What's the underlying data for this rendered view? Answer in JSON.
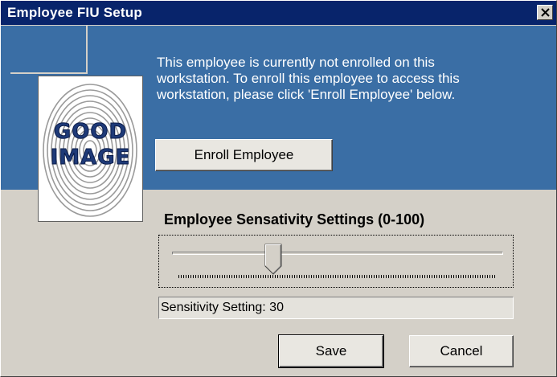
{
  "window": {
    "title": "Employee FIU Setup",
    "titlebar_color": "#08246b",
    "panel_color": "#3a6ea5"
  },
  "message": {
    "lines": [
      "This employee is currently not enrolled on this",
      "workstation.  To enroll this employee to access this",
      "workstation, please click 'Enroll Employee' below."
    ]
  },
  "fingerprint_card": {
    "icon": "fingerprint-icon",
    "line1": "GOOD",
    "line2": "IMAGE"
  },
  "buttons": {
    "enroll": "Enroll Employee",
    "save": "Save",
    "cancel": "Cancel",
    "close": "close-icon"
  },
  "sensitivity": {
    "title": "Employee Sensativity Settings (0-100)",
    "min": 0,
    "max": 100,
    "value": 30,
    "status_text": "Sensitivity Setting: 30"
  }
}
